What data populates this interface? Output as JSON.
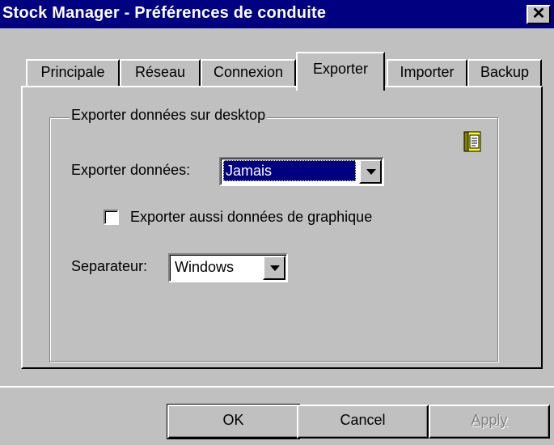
{
  "window": {
    "title": "Stock Manager - Préférences de conduite",
    "close_glyph": "✕"
  },
  "tabs": [
    {
      "label": "Principale",
      "active": false
    },
    {
      "label": "Réseau",
      "active": false
    },
    {
      "label": "Connexion",
      "active": false
    },
    {
      "label": "Exporter",
      "active": true
    },
    {
      "label": "Importer",
      "active": false
    },
    {
      "label": "Backup",
      "active": false
    }
  ],
  "export_group": {
    "title": "Exporter données sur desktop",
    "export_data_label": "Exporter données:",
    "export_data_value": "Jamais",
    "chart_checkbox_label": "Exporter aussi données de graphique",
    "chart_checkbox_checked": false,
    "separator_label": "Separateur:",
    "separator_value": "Windows",
    "help_icon": "book-icon"
  },
  "buttons": {
    "ok": "OK",
    "cancel": "Cancel",
    "apply": "Apply"
  },
  "colors": {
    "title_bar": "#000080",
    "face": "#c0c0c0",
    "selection": "#000080"
  }
}
